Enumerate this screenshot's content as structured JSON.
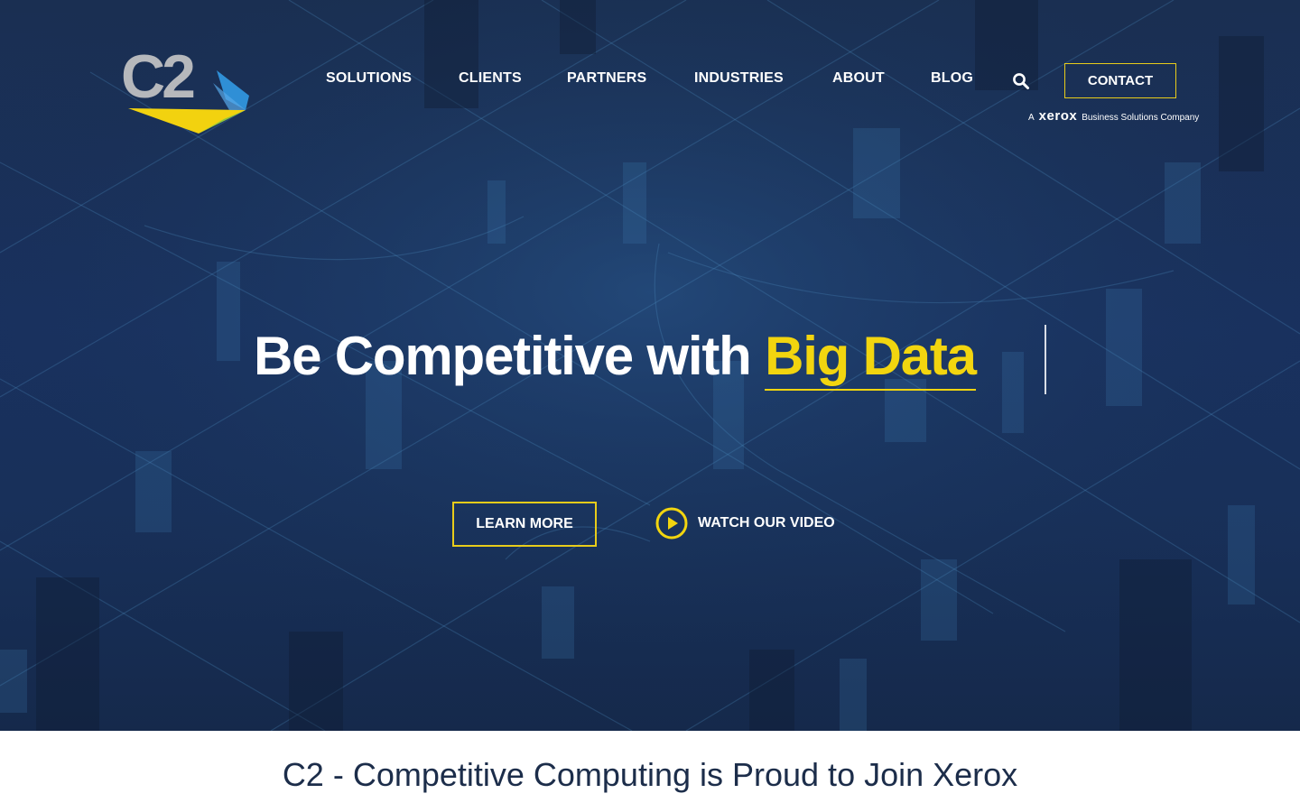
{
  "logo": {
    "text": "C2"
  },
  "nav": {
    "items": [
      {
        "label": "SOLUTIONS"
      },
      {
        "label": "CLIENTS"
      },
      {
        "label": "PARTNERS"
      },
      {
        "label": "INDUSTRIES"
      },
      {
        "label": "ABOUT"
      },
      {
        "label": "BLOG"
      }
    ],
    "search_icon": "search-icon",
    "contact_label": "CONTACT"
  },
  "xerox": {
    "prefix": "A",
    "brand": "xerox",
    "suffix": "Business Solutions Company"
  },
  "hero": {
    "headline_white": "Be Competitive with ",
    "headline_highlight": "Big Data",
    "learn_more": "LEARN MORE",
    "watch_video": "WATCH OUR VIDEO",
    "play_icon": "play-circle-icon"
  },
  "announcement": {
    "title": "C2 - Competitive Computing is Proud to Join Xerox"
  },
  "colors": {
    "hero_bg": "#193160",
    "accent_yellow": "#f2d50f",
    "button_border": "#e8cc1a",
    "heading_dark": "#1c2d4a"
  }
}
